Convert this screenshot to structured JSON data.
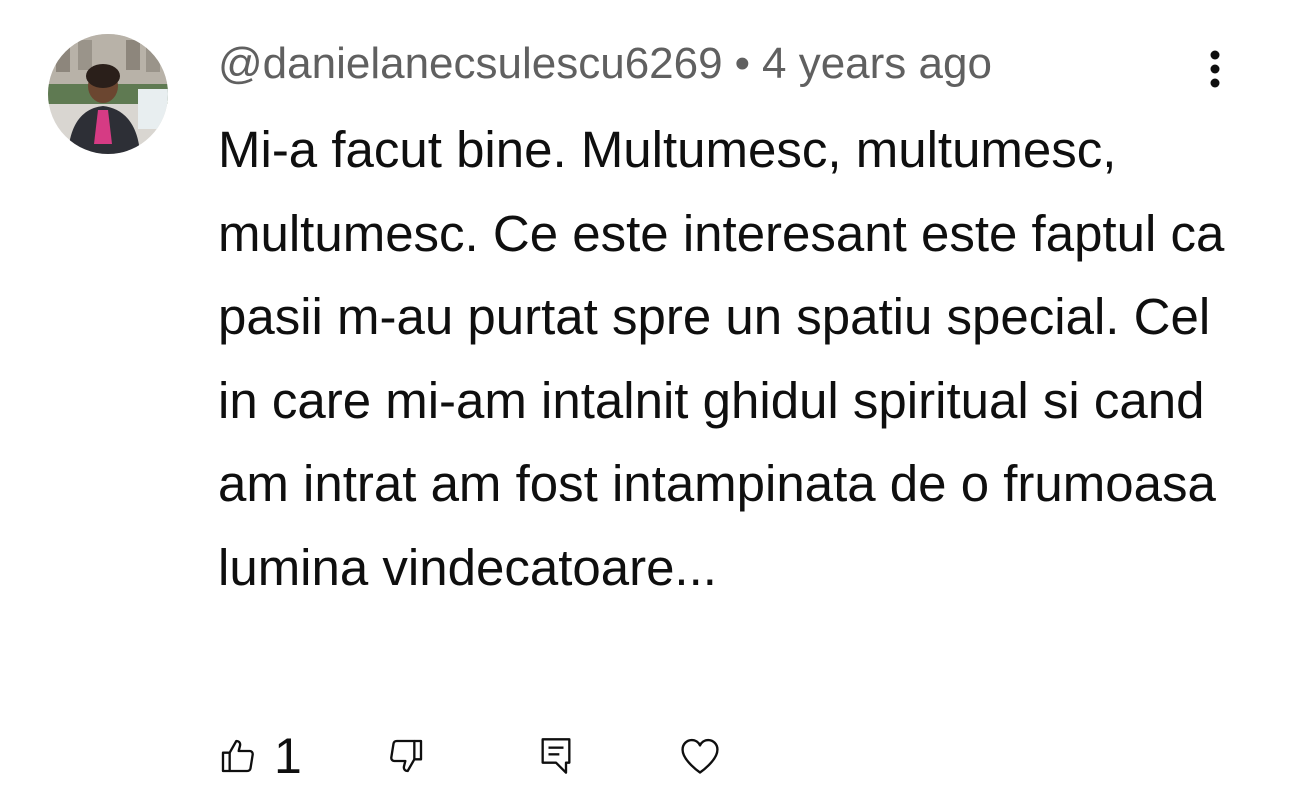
{
  "comment": {
    "author": "@danielanecsulescu6269",
    "separator": "•",
    "time": "4 years ago",
    "text": "Mi-a facut bine. Multumesc, multumesc, multumesc. Ce este interesant este faptul ca pasii m-au purtat spre un spatiu special. Cel in care mi-am intalnit ghidul spiritual si cand am intrat am fost intampinata de o frumoasa lumina vindecatoare...",
    "like_count": "1"
  },
  "icons": {
    "avatar": "user-avatar",
    "menu": "more-vertical-icon",
    "like": "thumbs-up-icon",
    "dislike": "thumbs-down-icon",
    "reply": "comment-icon",
    "heart": "heart-icon"
  },
  "colors": {
    "text": "#0f0f0f",
    "meta": "#606060",
    "background": "#ffffff"
  }
}
